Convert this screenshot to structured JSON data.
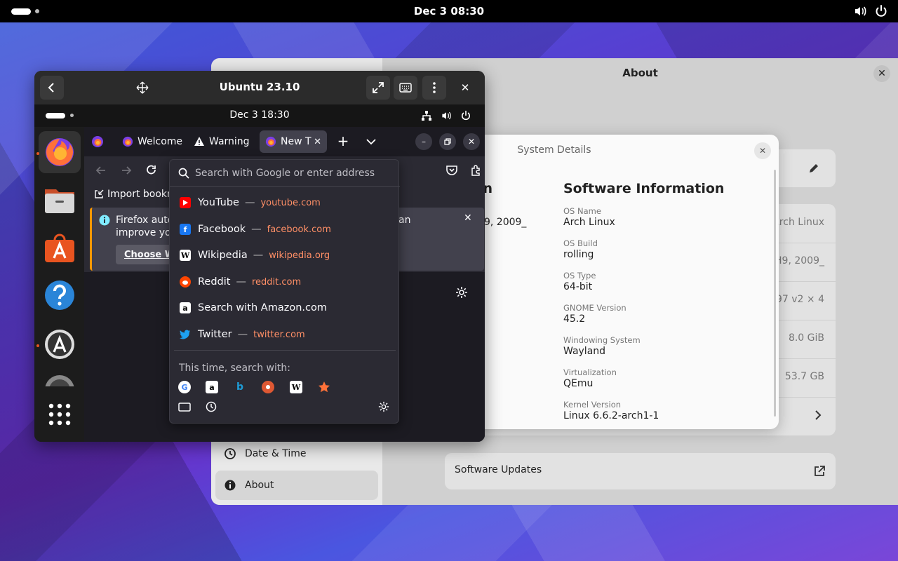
{
  "desktop": {
    "clock": "Dec 3  08:30"
  },
  "settings": {
    "title": "About",
    "sidebar": [
      {
        "label": "Date & Time",
        "icon": "clock-icon"
      },
      {
        "label": "About",
        "icon": "info-icon",
        "active": true
      }
    ],
    "right_values": [
      "Arch Linux",
      "H9, 2009_",
      "697 v2 × 4",
      "8.0 GiB",
      "53.7 GB"
    ],
    "software_updates": "Software Updates"
  },
  "system_details": {
    "title": "System Details",
    "hardware_heading_fragment": "n",
    "hardware_value_fragment": "9, 2009_",
    "software_heading": "Software Information",
    "items": [
      {
        "key": "OS Name",
        "value": "Arch Linux"
      },
      {
        "key": "OS Build",
        "value": "rolling"
      },
      {
        "key": "OS Type",
        "value": "64-bit"
      },
      {
        "key": "GNOME Version",
        "value": "45.2"
      },
      {
        "key": "Windowing System",
        "value": "Wayland"
      },
      {
        "key": "Virtualization",
        "value": "QEmu"
      },
      {
        "key": "Kernel Version",
        "value": "Linux 6.6.2-arch1-1"
      }
    ]
  },
  "vm": {
    "title": "Ubuntu 23.10",
    "guest_clock": "Dec 3  18:30"
  },
  "firefox": {
    "tabs": [
      {
        "label": "Welcome",
        "icon": "firefox-icon"
      },
      {
        "label": "Warning",
        "icon": "warning-icon"
      },
      {
        "label": "New T",
        "icon": "firefox-icon",
        "selected": true
      }
    ],
    "bookmarks_import": "Import bookm",
    "info_line1": "Firefox auto",
    "info_line2": "improve you",
    "info_right": "an",
    "info_button": "Choose W",
    "url_placeholder": "Search with Google or enter address",
    "suggestions": [
      {
        "title": "YouTube",
        "url": "youtube.com",
        "icon": "youtube-icon",
        "color": "#ff0000"
      },
      {
        "title": "Facebook",
        "url": "facebook.com",
        "icon": "facebook-icon",
        "color": "#1877f2"
      },
      {
        "title": "Wikipedia",
        "url": "wikipedia.org",
        "icon": "wikipedia-icon",
        "color": "#ffffff"
      },
      {
        "title": "Reddit",
        "url": "reddit.com",
        "icon": "reddit-icon",
        "color": "#ff4500"
      },
      {
        "title": "Search with Amazon.com",
        "url": "",
        "icon": "amazon-icon",
        "color": "#ffffff"
      },
      {
        "title": "Twitter",
        "url": "twitter.com",
        "icon": "twitter-icon",
        "color": "#1da1f2"
      }
    ],
    "search_with_label": "This time, search with:"
  }
}
